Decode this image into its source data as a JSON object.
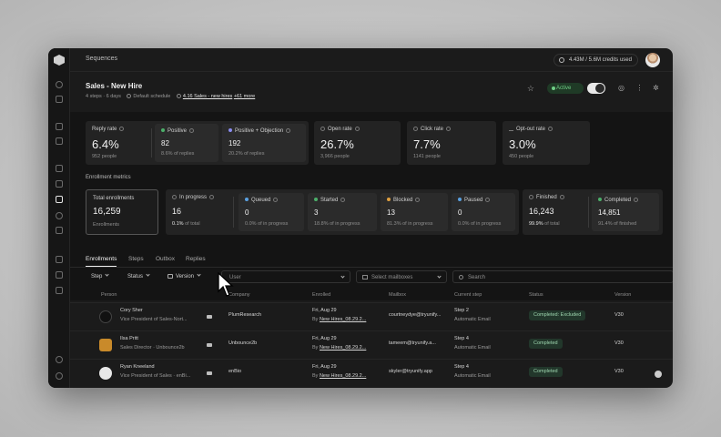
{
  "topbar": {
    "breadcrumb": "Sequences",
    "credits": "4.43M / 5.6M credits used"
  },
  "header": {
    "title": "Sales - New Hire",
    "steps": "4 steps · 6 days",
    "schedule": "Default schedule",
    "mailboxes": "4.16 Sales - new hires",
    "more": "+61 more",
    "status_badge": "Active"
  },
  "top_stats": [
    {
      "label": "Reply rate",
      "value": "6.4%",
      "sub": "952 people"
    },
    {
      "label": "Positive",
      "value": "82",
      "sub": "8.6% of replies",
      "dot_color": "#4caf6a"
    },
    {
      "label": "Positive + Objection",
      "value": "192",
      "sub": "20.2% of replies",
      "dot_color": "#8a8cf0"
    },
    {
      "label": "Open rate",
      "value": "26.7%",
      "sub": "3,966 people"
    },
    {
      "label": "Click rate",
      "value": "7.7%",
      "sub": "1141 people"
    },
    {
      "label": "Opt-out rate",
      "value": "3.0%",
      "sub": "450 people"
    }
  ],
  "section_label": "Enrollment metrics",
  "enrollment": {
    "total": {
      "label": "Total enrollments",
      "value": "16,259",
      "sub": "Enrollments"
    },
    "in_progress": {
      "label": "In progress",
      "value": "16",
      "pct": "0.1%",
      "sub": "of total"
    },
    "queued": {
      "label": "Queued",
      "value": "0",
      "sub": "0.0% of in progress"
    },
    "started": {
      "label": "Started",
      "value": "3",
      "sub": "18.8% of in progress"
    },
    "blocked": {
      "label": "Blocked",
      "value": "13",
      "sub": "81.3% of in progress"
    },
    "paused": {
      "label": "Paused",
      "value": "0",
      "sub": "0.0% of in progress"
    },
    "finished": {
      "label": "Finished",
      "value": "16,243",
      "pct": "99.9%",
      "sub": "of total"
    },
    "completed": {
      "label": "Completed",
      "value": "14,851",
      "sub": "91.4% of finished"
    }
  },
  "tabs": [
    "Enrollments",
    "Steps",
    "Outbox",
    "Replies"
  ],
  "filters": {
    "step": "Step",
    "status": "Status",
    "version": "Version",
    "user_placeholder": "User",
    "mailbox_placeholder": "Select mailboxes",
    "search_placeholder": "Search"
  },
  "columns": [
    "Person",
    "Company",
    "Enrolled",
    "Mailbox",
    "Current step",
    "Status",
    "Version"
  ],
  "rows": [
    {
      "name": "Cory Sher",
      "title": "Vice President of Sales-Nort...",
      "company": "PlumResearch",
      "enrolled_date": "Fri, Aug 29",
      "enrolled_by": "New Hires_08.29.2...",
      "mailbox": "courtneydye@tryunify...",
      "step": "Step 2",
      "step_type": "Automatic Email",
      "status": "Completed: Excluded",
      "version": "V30",
      "logo_color": "#111111"
    },
    {
      "name": "Ilsa Pritt",
      "title": "Sales Director · Unbounce2b",
      "company": "Unbounce2b",
      "enrolled_date": "Fri, Aug 29",
      "enrolled_by": "New Hires_08.29.2...",
      "mailbox": "tameem@tryunify.a...",
      "step": "Step 4",
      "step_type": "Automatic Email",
      "status": "Completed",
      "version": "V30",
      "logo_color": "#c98a2a"
    },
    {
      "name": "Ryan Kneeland",
      "title": "Vice President of Sales · enBi...",
      "company": "enBio",
      "enrolled_date": "Fri, Aug 29",
      "enrolled_by": "New Hires_08.29.2...",
      "mailbox": "skyler@tryunify.app",
      "step": "Step 4",
      "step_type": "Automatic Email",
      "status": "Completed",
      "version": "V30",
      "logo_color": "#e8e8e8"
    }
  ],
  "colors": {
    "active": "#6fcf86",
    "background": "#1b1b1b"
  }
}
